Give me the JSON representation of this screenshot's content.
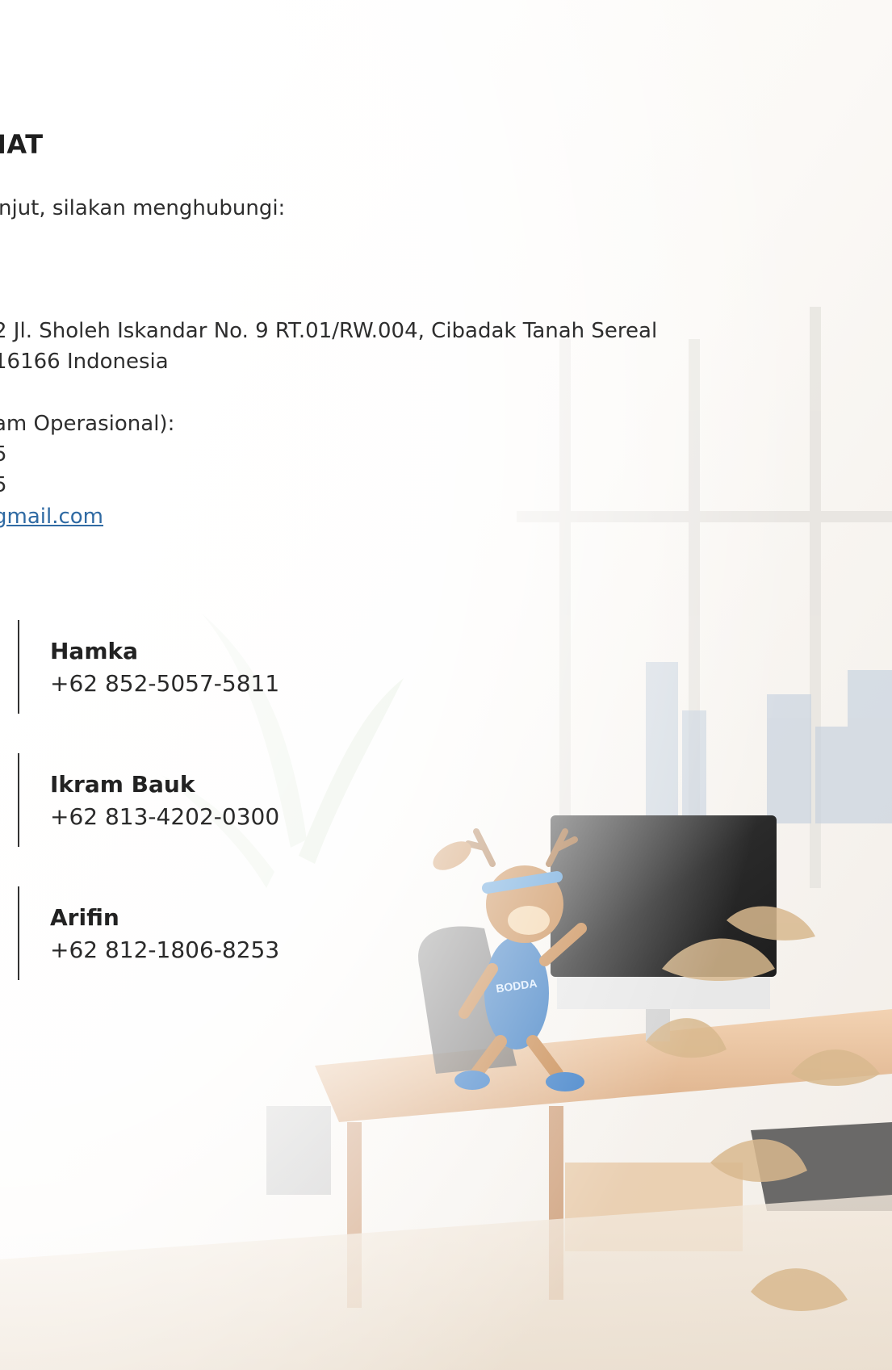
{
  "heading": "IAT",
  "intro": "njut, silakan menghubungi:",
  "address": {
    "line1": "2 Jl. Sholeh Iskandar No. 9 RT.01/RW.004, Cibadak Tanah Sereal",
    "line2": "16166 Indonesia"
  },
  "hours": {
    "label": "am Operasional):",
    "line1": "5",
    "line2": "5",
    "email": "gmail.com"
  },
  "contacts": [
    {
      "name": "Hamka",
      "phone": "+62 852-5057-5811"
    },
    {
      "name": "Ikram Bauk",
      "phone": "+62 813-4202-0300"
    },
    {
      "name": "Arifin",
      "phone": "+62 812-1806-8253"
    }
  ],
  "illustration": {
    "mascot_shirt_text": "BODDA",
    "icon": "watercolor-office-illustration"
  }
}
